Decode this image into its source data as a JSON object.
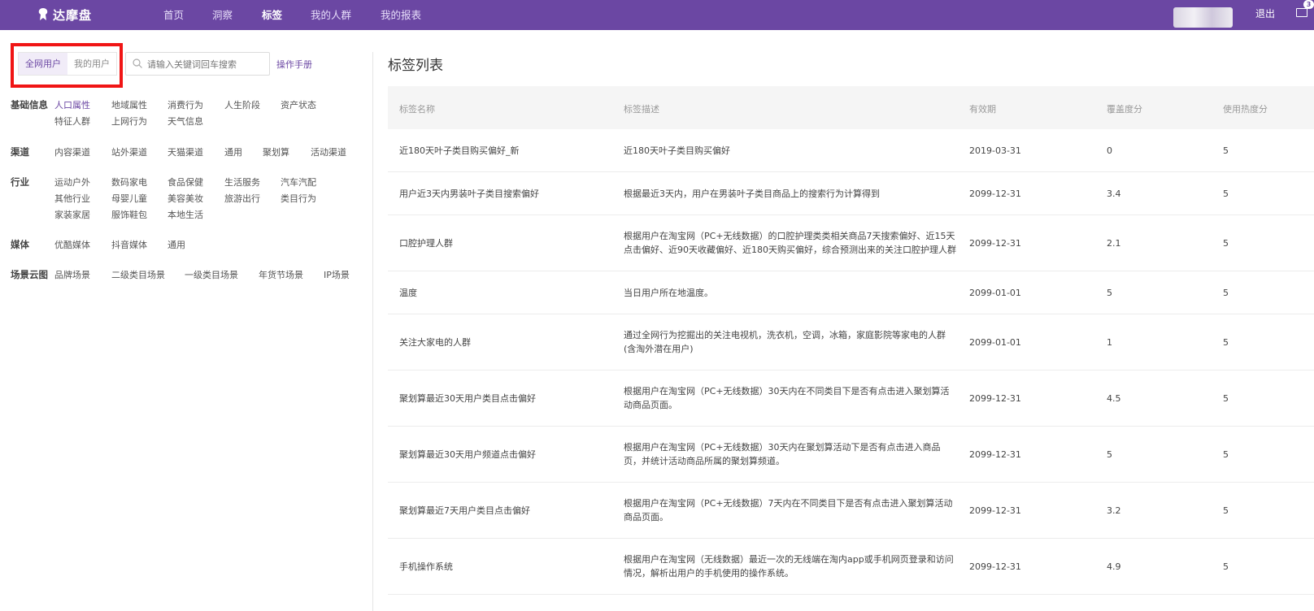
{
  "header": {
    "logo_text": "达摩盘",
    "nav": [
      {
        "label": "首页"
      },
      {
        "label": "洞察"
      },
      {
        "label": "标签",
        "active": true
      },
      {
        "label": "我的人群"
      },
      {
        "label": "我的报表"
      }
    ],
    "logout_label": "退出",
    "mail_badge": "3"
  },
  "left": {
    "toggle": [
      {
        "label": "全网用户",
        "active": true
      },
      {
        "label": "我的用户"
      }
    ],
    "search_placeholder": "请输入关键词回车搜索",
    "manual_label": "操作手册",
    "categories": [
      {
        "label": "基础信息",
        "items": [
          "人口属性",
          "地域属性",
          "消费行为",
          "人生阶段",
          "资产状态",
          "特征人群",
          "上网行为",
          "天气信息"
        ]
      },
      {
        "label": "渠道",
        "items": [
          "内容渠道",
          "站外渠道",
          "天猫渠道",
          "通用",
          "聚划算",
          "活动渠道"
        ]
      },
      {
        "label": "行业",
        "items": [
          "运动户外",
          "数码家电",
          "食品保健",
          "生活服务",
          "汽车汽配",
          "其他行业",
          "母婴儿童",
          "美容美妆",
          "旅游出行",
          "类目行为",
          "家装家居",
          "服饰鞋包",
          "本地生活"
        ]
      },
      {
        "label": "媒体",
        "items": [
          "优酷媒体",
          "抖音媒体",
          "通用"
        ]
      },
      {
        "label": "场景云图",
        "items": [
          "品牌场景",
          "二级类目场景",
          "一级类目场景",
          "年货节场景",
          "IP场景"
        ]
      }
    ]
  },
  "main": {
    "title": "标签列表",
    "columns": [
      "标签名称",
      "标签描述",
      "有效期",
      "覆盖度分",
      "使用热度分"
    ],
    "rows": [
      {
        "name": "近180天叶子类目购买偏好_新",
        "desc": "近180天叶子类目购买偏好",
        "expiry": "2019-03-31",
        "coverage": "0",
        "heat": "5"
      },
      {
        "name": "用户近3天内男装叶子类目搜索偏好",
        "desc": "根据最近3天内，用户在男装叶子类目商品上的搜索行为计算得到",
        "expiry": "2099-12-31",
        "coverage": "3.4",
        "heat": "5"
      },
      {
        "name": "口腔护理人群",
        "desc": "根据用户在淘宝网（PC+无线数据）的口腔护理类类相关商品7天搜索偏好、近15天点击偏好、近90天收藏偏好、近180天购买偏好，综合预测出来的关注口腔护理人群",
        "expiry": "2099-12-31",
        "coverage": "2.1",
        "heat": "5"
      },
      {
        "name": "温度",
        "desc": "当日用户所在地温度。",
        "expiry": "2099-01-01",
        "coverage": "5",
        "heat": "5"
      },
      {
        "name": "关注大家电的人群",
        "desc": "通过全网行为挖掘出的关注电视机，洗衣机，空调，冰箱，家庭影院等家电的人群(含淘外潜在用户)",
        "expiry": "2099-01-01",
        "coverage": "1",
        "heat": "5"
      },
      {
        "name": "聚划算最近30天用户类目点击偏好",
        "desc": "根据用户在淘宝网（PC+无线数据）30天内在不同类目下是否有点击进入聚划算活动商品页面。",
        "expiry": "2099-12-31",
        "coverage": "4.5",
        "heat": "5"
      },
      {
        "name": "聚划算最近30天用户频道点击偏好",
        "desc": "根据用户在淘宝网（PC+无线数据）30天内在聚划算活动下是否有点击进入商品页，并统计活动商品所属的聚划算频道。",
        "expiry": "2099-12-31",
        "coverage": "5",
        "heat": "5"
      },
      {
        "name": "聚划算最近7天用户类目点击偏好",
        "desc": "根据用户在淘宝网（PC+无线数据）7天内在不同类目下是否有点击进入聚划算活动商品页面。",
        "expiry": "2099-12-31",
        "coverage": "3.2",
        "heat": "5"
      },
      {
        "name": "手机操作系统",
        "desc": "根据用户在淘宝网（无线数据）最近一次的无线端在淘内app或手机网页登录和访问情况，解析出用户的手机使用的操作系统。",
        "expiry": "2099-12-31",
        "coverage": "4.9",
        "heat": "5"
      }
    ]
  }
}
